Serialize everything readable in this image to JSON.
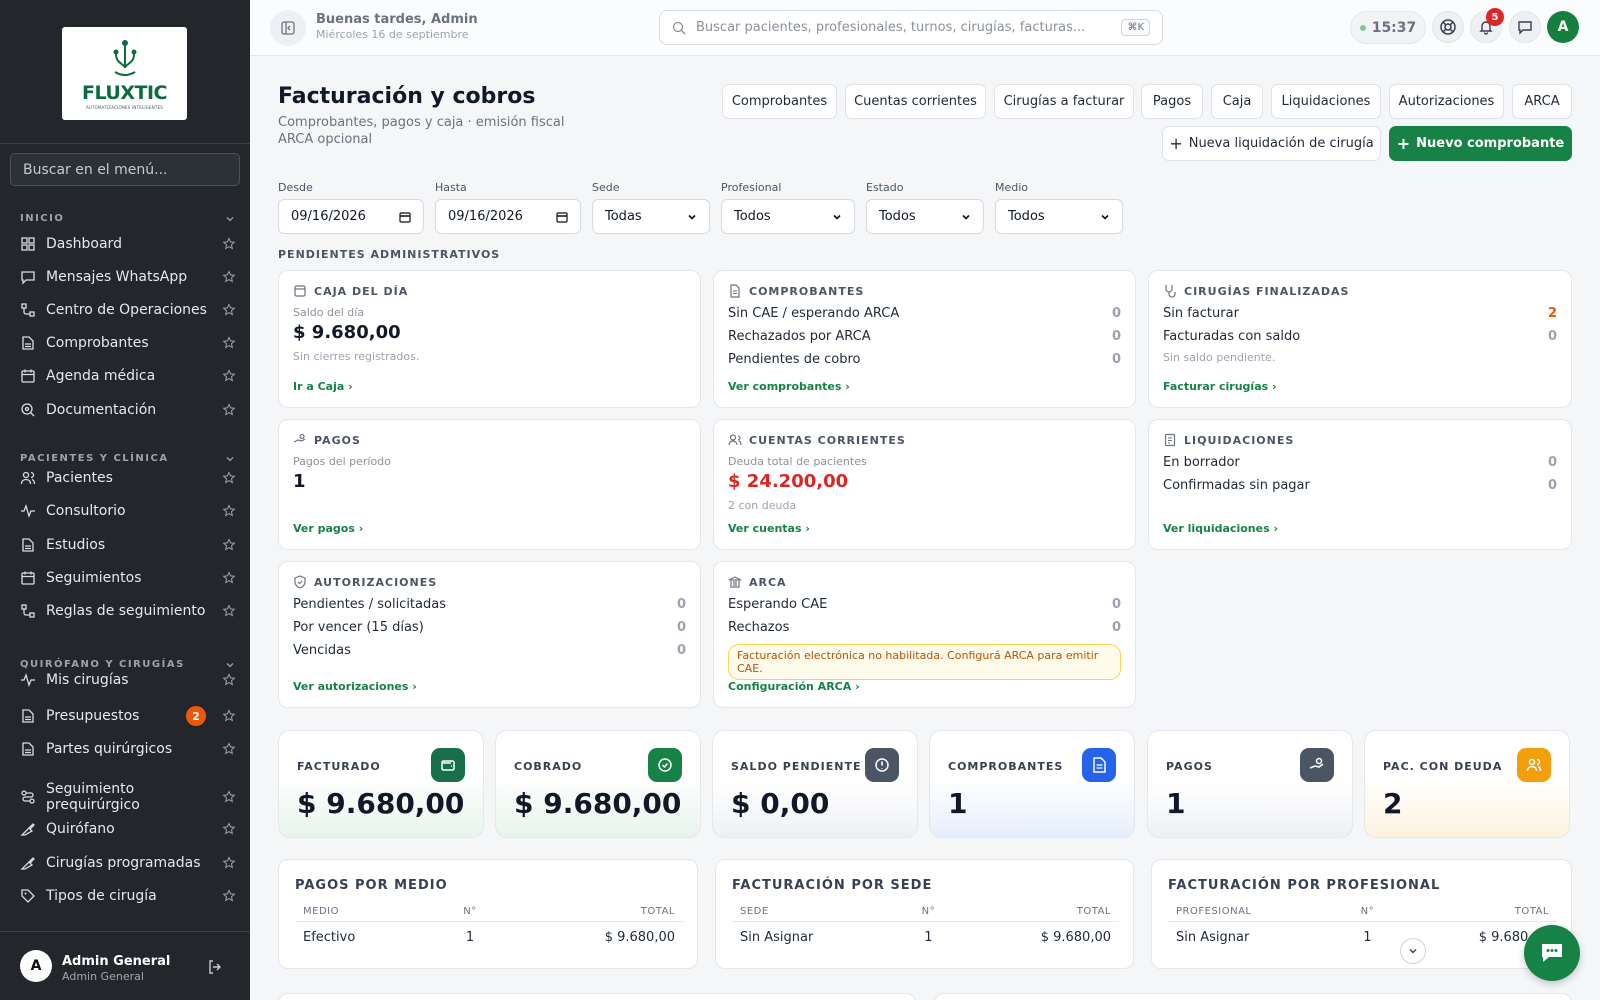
{
  "sidebar": {
    "logo": {
      "word": "FLUXTIC",
      "tagline": "AUTOMATIZACIONES INTELIGENTES"
    },
    "search_placeholder": "Buscar en el menú...",
    "sections": [
      {
        "title": "INICIO"
      },
      {
        "title": "PACIENTES Y CLÍNICA"
      },
      {
        "title": "QUIRÓFANO Y CIRUGÍAS"
      }
    ],
    "items": [
      {
        "label": "Dashboard",
        "icon": "grid-icon"
      },
      {
        "label": "Mensajes WhatsApp",
        "icon": "message-icon"
      },
      {
        "label": "Centro de Operaciones",
        "icon": "flow-icon"
      },
      {
        "label": "Comprobantes",
        "icon": "file-icon"
      },
      {
        "label": "Agenda médica",
        "icon": "calendar-icon"
      },
      {
        "label": "Documentación",
        "icon": "doc-search-icon"
      },
      {
        "label": "Pacientes",
        "icon": "users-icon"
      },
      {
        "label": "Consultorio",
        "icon": "activity-icon"
      },
      {
        "label": "Estudios",
        "icon": "file-icon"
      },
      {
        "label": "Seguimientos",
        "icon": "calendar-icon"
      },
      {
        "label": "Reglas de seguimiento",
        "icon": "flow-icon"
      },
      {
        "label": "Mis cirugías",
        "icon": "activity-icon"
      },
      {
        "label": "Presupuestos",
        "icon": "file-icon",
        "badge": "2"
      },
      {
        "label": "Partes quirúrgicos",
        "icon": "file-icon"
      },
      {
        "label": "Seguimiento prequirúrgico",
        "icon": "route-icon"
      },
      {
        "label": "Quirófano",
        "icon": "scalpel-icon"
      },
      {
        "label": "Cirugías programadas",
        "icon": "scalpel-icon"
      },
      {
        "label": "Tipos de cirugía",
        "icon": "tag-icon"
      }
    ],
    "user": {
      "initial": "A",
      "name": "Admin General",
      "role": "Admin General"
    }
  },
  "topbar": {
    "greeting": "Buenas tardes, Admin",
    "date": "Miércoles 16 de septiembre",
    "search_placeholder": "Buscar pacientes, profesionales, turnos, cirugías, facturas...",
    "shortcut": "⌘K",
    "time": "15:37",
    "notifications": "5",
    "avatar": "A"
  },
  "page": {
    "title": "Facturación y cobros",
    "subtitle": "Comprobantes, pagos y caja · emisión fiscal ARCA opcional",
    "tabs": [
      "Comprobantes",
      "Cuentas corrientes",
      "Cirugías a facturar",
      "Pagos",
      "Caja",
      "Liquidaciones",
      "Autorizaciones",
      "ARCA"
    ],
    "btn_liquidacion": "Nueva liquidación de cirugía",
    "btn_comprobante": "Nuevo comprobante"
  },
  "filters": {
    "desde_label": "Desde",
    "desde": "09/16/2026",
    "hasta_label": "Hasta",
    "hasta": "09/16/2026",
    "sede_label": "Sede",
    "sede": "Todas",
    "profesional_label": "Profesional",
    "profesional": "Todos",
    "estado_label": "Estado",
    "estado": "Todos",
    "medio_label": "Medio",
    "medio": "Todos"
  },
  "pending": {
    "title": "PENDIENTES ADMINISTRATIVOS",
    "caja": {
      "title": "CAJA DEL DÍA",
      "label": "Saldo del día",
      "value": "$ 9.680,00",
      "note": "Sin cierres registrados.",
      "link": "Ir a Caja"
    },
    "comprobantes": {
      "title": "COMPROBANTES",
      "rows": [
        {
          "label": "Sin CAE / esperando ARCA",
          "value": "0"
        },
        {
          "label": "Rechazados por ARCA",
          "value": "0"
        },
        {
          "label": "Pendientes de cobro",
          "value": "0"
        }
      ],
      "link": "Ver comprobantes"
    },
    "cirugias": {
      "title": "CIRUGÍAS FINALIZADAS",
      "rows": [
        {
          "label": "Sin facturar",
          "value": "2"
        },
        {
          "label": "Facturadas con saldo",
          "value": "0"
        }
      ],
      "note": "Sin saldo pendiente.",
      "link": "Facturar cirugías"
    },
    "pagos": {
      "title": "PAGOS",
      "label": "Pagos del período",
      "value": "1",
      "link": "Ver pagos"
    },
    "cuentas": {
      "title": "CUENTAS CORRIENTES",
      "label": "Deuda total de pacientes",
      "value": "$ 24.200,00",
      "note": "2 con deuda",
      "link": "Ver cuentas"
    },
    "liquidaciones": {
      "title": "LIQUIDACIONES",
      "rows": [
        {
          "label": "En borrador",
          "value": "0"
        },
        {
          "label": "Confirmadas sin pagar",
          "value": "0"
        }
      ],
      "link": "Ver liquidaciones"
    },
    "autorizaciones": {
      "title": "AUTORIZACIONES",
      "rows": [
        {
          "label": "Pendientes / solicitadas",
          "value": "0"
        },
        {
          "label": "Por vencer (15 días)",
          "value": "0"
        },
        {
          "label": "Vencidas",
          "value": "0"
        }
      ],
      "link": "Ver autorizaciones"
    },
    "arca": {
      "title": "ARCA",
      "rows": [
        {
          "label": "Esperando CAE",
          "value": "0"
        },
        {
          "label": "Rechazos",
          "value": "0"
        }
      ],
      "warning": "Facturación electrónica no habilitada. Configurá ARCA para emitir CAE.",
      "link": "Configuración ARCA"
    }
  },
  "kpis": [
    {
      "label": "FACTURADO",
      "value": "$ 9.680,00",
      "icon": "wallet-icon",
      "color": "#17704a"
    },
    {
      "label": "COBRADO",
      "value": "$ 9.680,00",
      "icon": "check-circle-icon",
      "color": "#168246"
    },
    {
      "label": "SALDO PENDIENTE",
      "value": "$ 0,00",
      "icon": "alert-circle-icon",
      "color": "#4b5563"
    },
    {
      "label": "COMPROBANTES",
      "value": "1",
      "icon": "document-icon",
      "color": "#2563eb"
    },
    {
      "label": "PAGOS",
      "value": "1",
      "icon": "hand-coins-icon",
      "color": "#4b5563"
    },
    {
      "label": "PAC. CON DEUDA",
      "value": "2",
      "icon": "users-icon",
      "color": "#f59e0b"
    }
  ],
  "tables": {
    "medio": {
      "title": "PAGOS POR MEDIO",
      "headers": [
        "MEDIO",
        "N°",
        "TOTAL"
      ],
      "rows": [
        [
          "Efectivo",
          "1",
          "$ 9.680,00"
        ]
      ]
    },
    "sede": {
      "title": "FACTURACIÓN POR SEDE",
      "headers": [
        "SEDE",
        "N°",
        "TOTAL"
      ],
      "rows": [
        [
          "Sin Asignar",
          "1",
          "$ 9.680,00"
        ]
      ]
    },
    "profesional": {
      "title": "FACTURACIÓN POR PROFESIONAL",
      "headers": [
        "PROFESIONAL",
        "N°",
        "TOTAL"
      ],
      "rows": [
        [
          "Sin Asignar",
          "1",
          "$ 9.680,00"
        ]
      ]
    }
  }
}
